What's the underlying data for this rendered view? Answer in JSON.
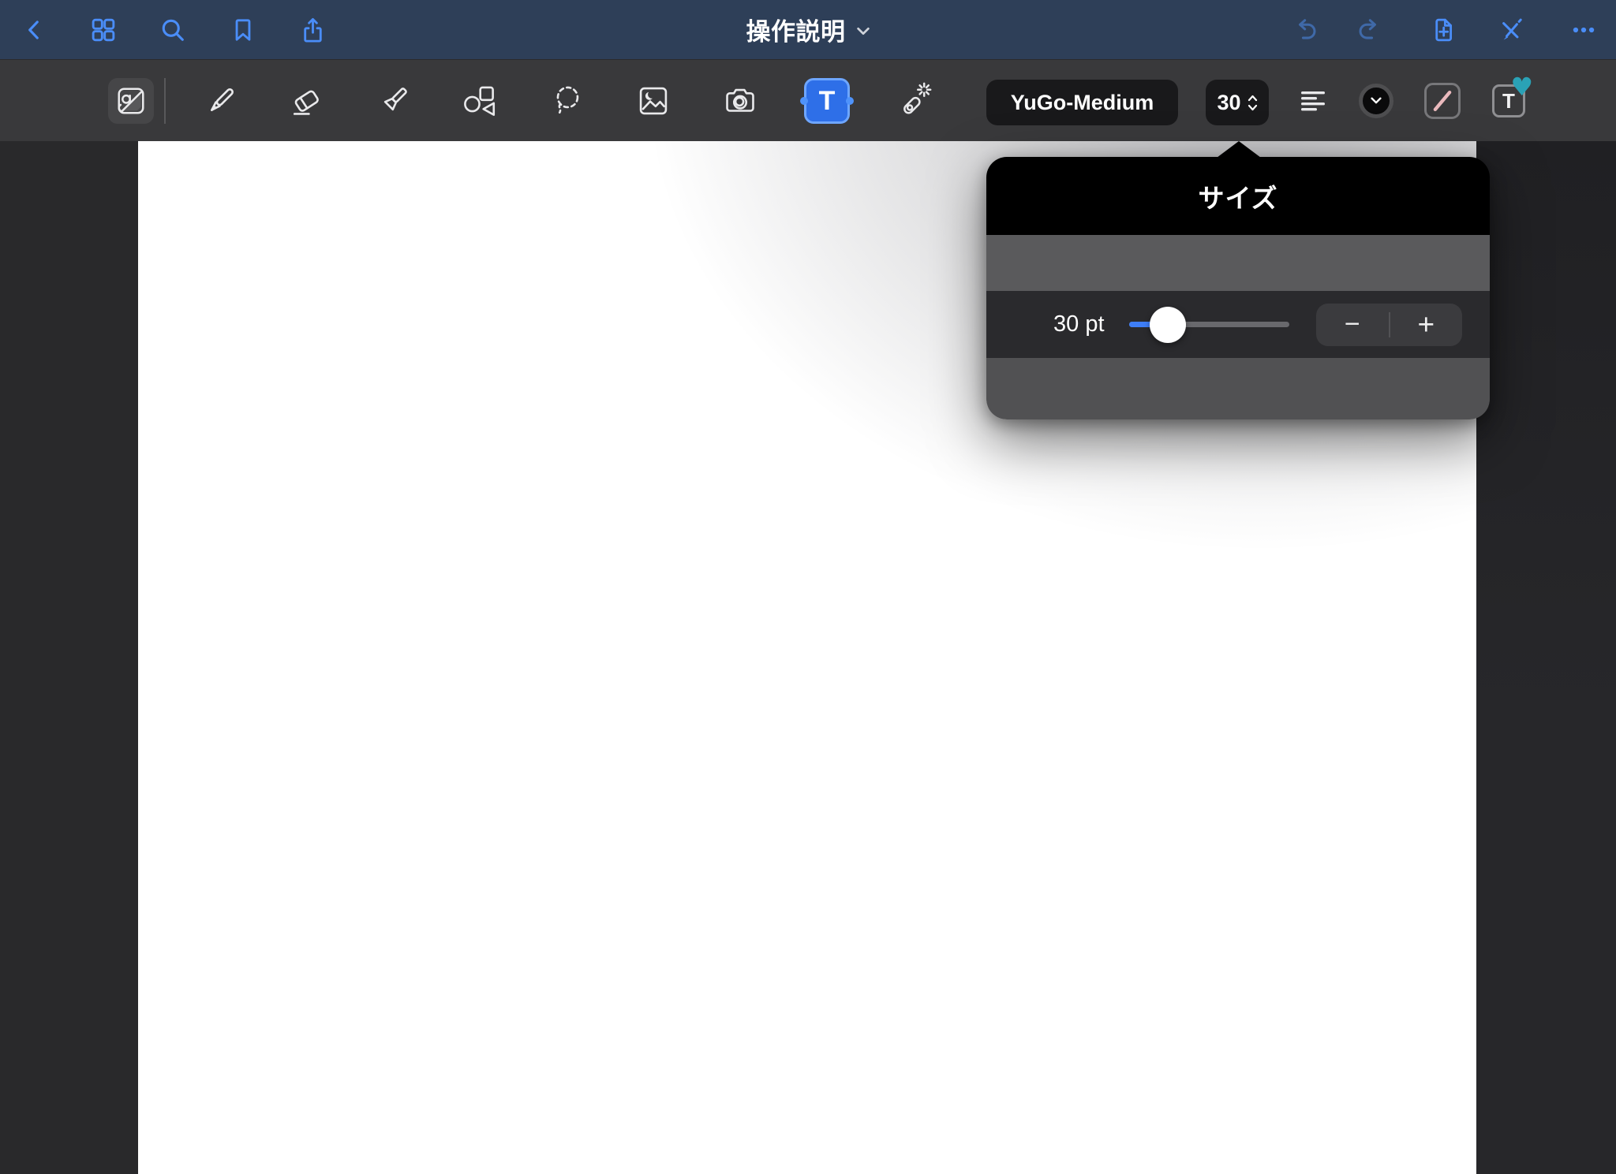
{
  "top_nav": {
    "title": "操作説明"
  },
  "toolbar": {
    "font_name": "YuGo-Medium",
    "font_size": "30",
    "text_tool_letter": "T",
    "favorite_letter": "T"
  },
  "popover": {
    "title": "サイズ",
    "value_label": "30 pt",
    "minus": "−",
    "plus": "+",
    "slider": {
      "value": 30,
      "unit": "pt",
      "percent": 24
    }
  },
  "colors": {
    "nav_bg": "#2e3f58",
    "toolbar_bg": "#39393b",
    "accent_blue": "#4a8df8",
    "accent_blue_dim": "#3f69a8",
    "slider_blue": "#3e7ef7",
    "heart_teal": "#2aa2b6",
    "stroke_pink": "#eab9bd",
    "icon_light": "#e9e9eb"
  }
}
